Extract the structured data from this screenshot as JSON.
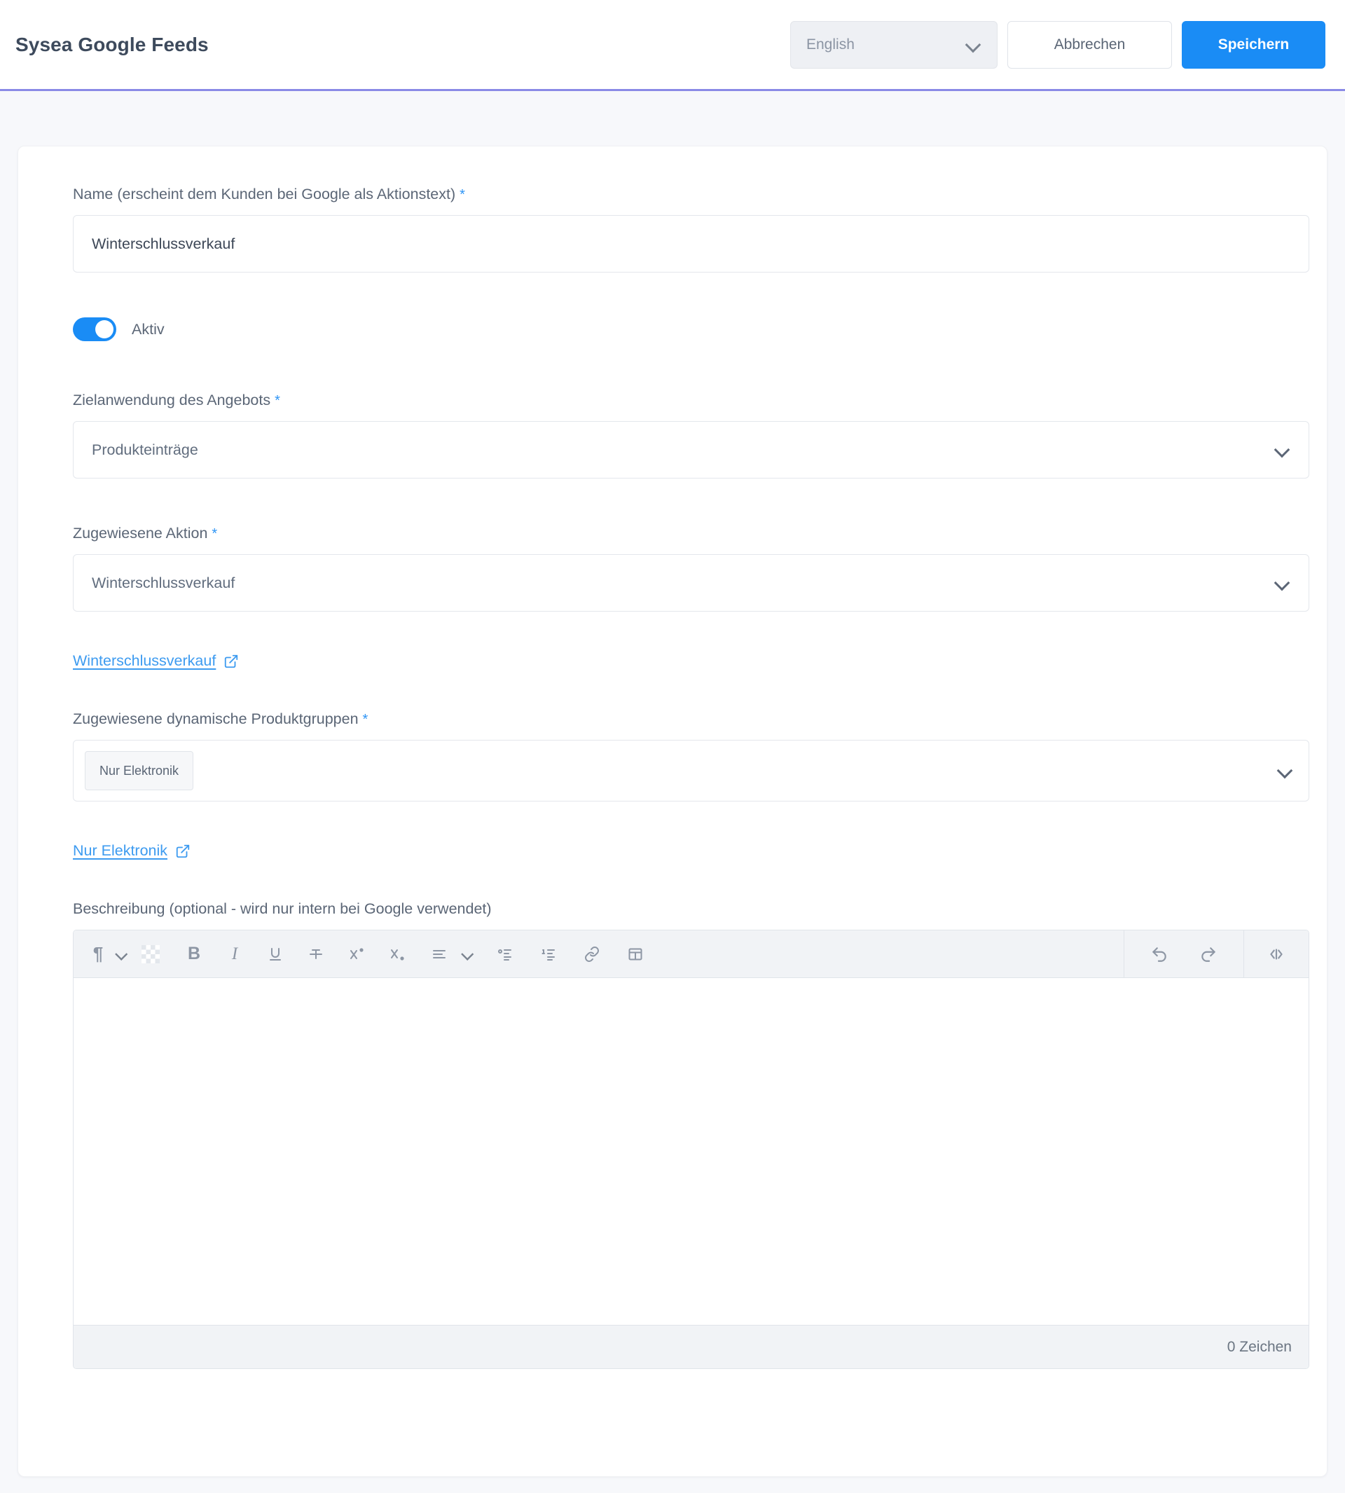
{
  "header": {
    "title": "Sysea Google Feeds",
    "language_value": "English",
    "cancel_label": "Abbrechen",
    "save_label": "Speichern"
  },
  "form": {
    "name_field": {
      "label": "Name (erscheint dem Kunden bei Google als Aktionstext)",
      "required_marker": "*",
      "value": "Winterschlussverkauf"
    },
    "active_toggle": {
      "label": "Aktiv",
      "state": "on"
    },
    "target_field": {
      "label": "Zielanwendung des Angebots",
      "required_marker": "*",
      "value": "Produkteinträge"
    },
    "promotion_field": {
      "label": "Zugewiesene Aktion",
      "required_marker": "*",
      "value": "Winterschlussverkauf"
    },
    "promotion_link": {
      "label": "Winterschlussverkauf"
    },
    "product_groups_field": {
      "label": "Zugewiesene dynamische Produktgruppen",
      "required_marker": "*",
      "chips": [
        "Nur Elektronik"
      ]
    },
    "product_group_link": {
      "label": "Nur Elektronik"
    },
    "description_field": {
      "label": "Beschreibung (optional - wird nur intern bei Google verwendet)",
      "content": "",
      "char_count": "0 Zeichen"
    }
  },
  "editor_toolbar": {
    "paragraph": "¶",
    "bold": "B",
    "italic": "I"
  },
  "colors": {
    "accent": "#1a8cf5",
    "link": "#3d9bf0",
    "header_rule": "#8a8ae6",
    "page_bg": "#f7f8fb",
    "toolbar_bg": "#f1f3f6"
  }
}
